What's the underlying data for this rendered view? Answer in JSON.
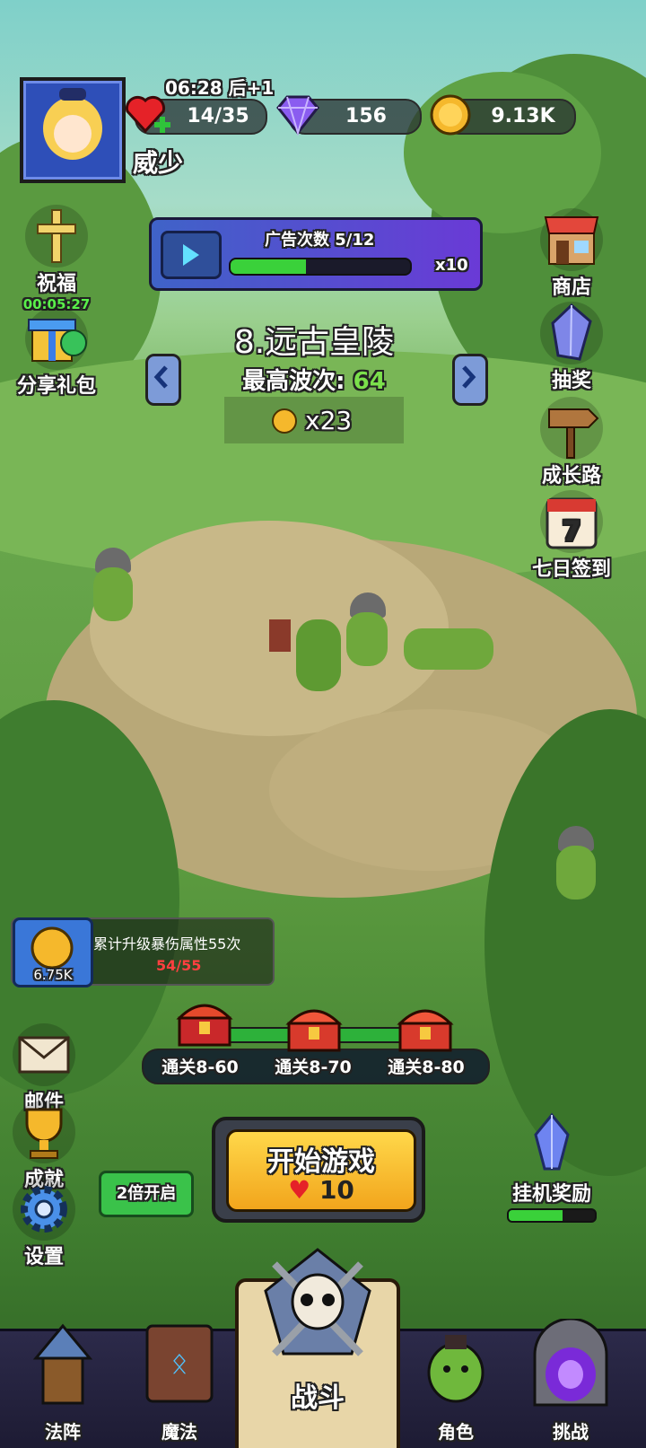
{
  "player": {
    "name": "威少",
    "timer": "06:28",
    "timer_suffix": "后+1"
  },
  "resources": {
    "energy": "14/35",
    "gems": "156",
    "gold": "9.13K"
  },
  "ad_panel": {
    "label": "广告次数",
    "count": "5/12",
    "multiplier": "x10",
    "progress": 0.42
  },
  "stage": {
    "name": "8.远古皇陵",
    "best_wave_label": "最高波次:",
    "best_wave": "64",
    "reward": "x23"
  },
  "left_menu": {
    "bless": {
      "label": "祝福",
      "timer": "00:05:27"
    },
    "share": {
      "label": "分享礼包"
    }
  },
  "right_menu": {
    "shop": "商店",
    "draw": "抽奖",
    "growth": "成长路",
    "checkin": "七日签到",
    "checkin_day": "7"
  },
  "quest": {
    "text": "累计升级暴伤属性55次",
    "progress": "54/55",
    "reward": "6.75K"
  },
  "chests": [
    "通关8-60",
    "通关8-70",
    "通关8-80"
  ],
  "lower_left": {
    "mail": "邮件",
    "achievement": "成就",
    "settings": "设置"
  },
  "speed_button": "2倍开启",
  "start": {
    "label": "开始游戏",
    "cost": "10"
  },
  "idle": {
    "label": "挂机奖励",
    "progress": 0.62
  },
  "nav": {
    "formation": "法阵",
    "magic": "魔法",
    "battle": "战斗",
    "character": "角色",
    "challenge": "挑战",
    "magic_rune": "ᛟ"
  },
  "colors": {
    "best_wave": "#7be04b",
    "quest_progress": "#ff4040",
    "accent_gold": "#ffcc33"
  }
}
